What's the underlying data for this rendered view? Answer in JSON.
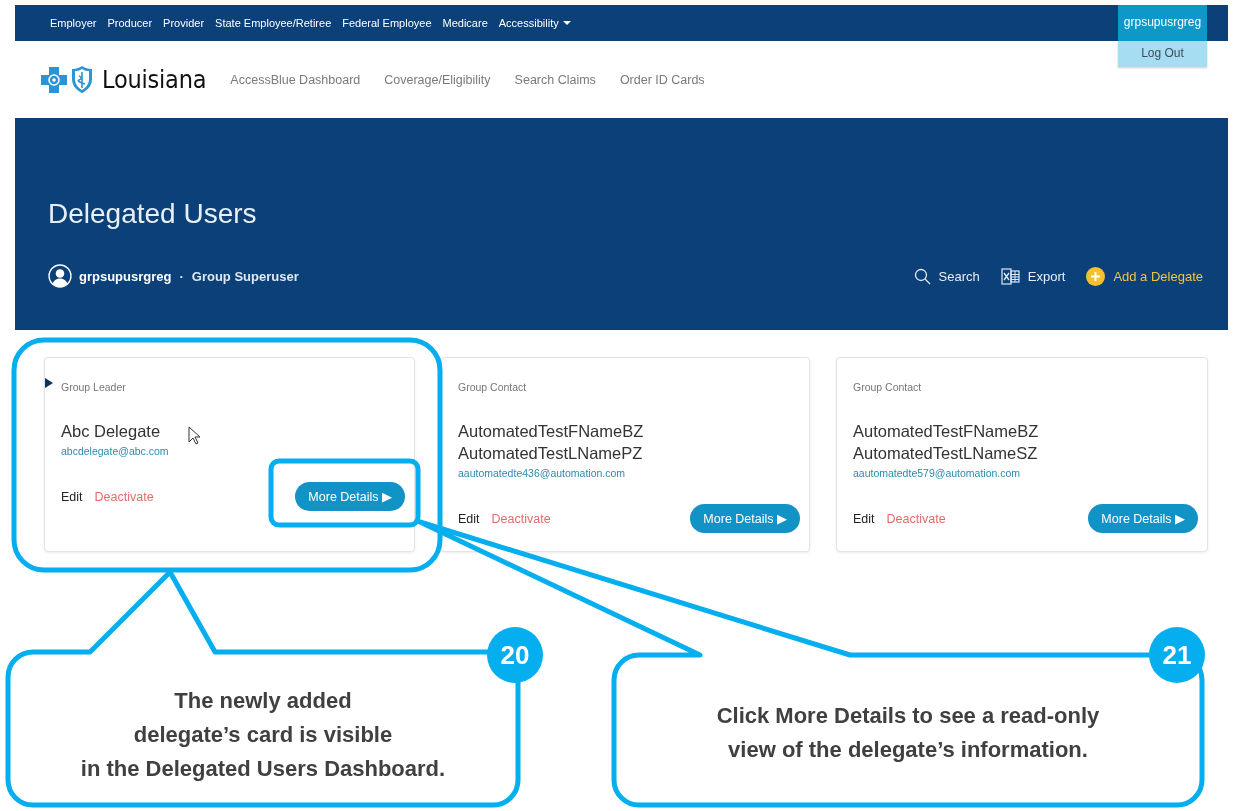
{
  "top_nav": {
    "links": [
      {
        "label": "Employer",
        "kind": "link"
      },
      {
        "label": "Producer",
        "kind": "link"
      },
      {
        "label": "Provider",
        "kind": "link"
      },
      {
        "label": "State Employee/Retiree",
        "kind": "link"
      },
      {
        "label": "Federal Employee",
        "kind": "link"
      },
      {
        "label": "Medicare",
        "kind": "link"
      },
      {
        "label": "Accessibility",
        "kind": "dropdown"
      }
    ],
    "user_menu": {
      "username": "grpsupusrgreg",
      "expanded": true,
      "items": [
        "Log Out"
      ]
    }
  },
  "header": {
    "logo_text": "Louisiana",
    "nav": [
      "AccessBlue Dashboard",
      "Coverage/Eligibility",
      "Search Claims",
      "Order ID Cards"
    ]
  },
  "hero": {
    "title": "Delegated Users",
    "user": {
      "name": "grpsupusrgreg",
      "separator": "·",
      "role": "Group Superuser"
    },
    "actions": [
      {
        "kind": "search",
        "label": "Search"
      },
      {
        "kind": "export",
        "label": "Export"
      },
      {
        "kind": "add",
        "label": "Add a Delegate"
      }
    ]
  },
  "cards": [
    {
      "role": "Group Leader",
      "kind": "leader",
      "name_lines": [
        "Abc Delegate"
      ],
      "email": "abcdelegate@abc.com",
      "edit": "Edit",
      "deactivate": "Deactivate",
      "button": "More Details",
      "button_icon": "▶",
      "pointer": true
    },
    {
      "role": "Group Contact",
      "kind": "contact",
      "name_lines": [
        "AutomatedTestFNameBZ",
        "AutomatedTestLNamePZ"
      ],
      "email": "aautomatedte436@automation.com",
      "edit": "Edit",
      "deactivate": "Deactivate",
      "button": "More Details",
      "button_icon": "▶",
      "pointer": false
    },
    {
      "role": "Group Contact",
      "kind": "contact",
      "name_lines": [
        "AutomatedTestFNameBZ",
        "AutomatedTestLNameSZ"
      ],
      "email": "aautomatedte579@automation.com",
      "edit": "Edit",
      "deactivate": "Deactivate",
      "button": "More Details",
      "button_icon": "▶",
      "pointer": false
    }
  ],
  "callouts": [
    {
      "number": "20",
      "text": "The newly added\ndelegate’s card is visible\nin the Delegated Users Dashboard."
    },
    {
      "number": "21",
      "text": "Click More Details to see a read-only\nview of the delegate’s information."
    }
  ]
}
